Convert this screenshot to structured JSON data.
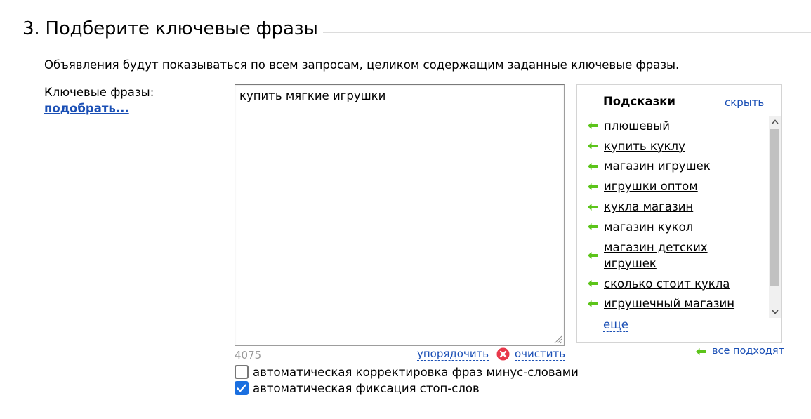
{
  "section": {
    "title": "3. Подберите ключевые фразы",
    "description": "Объявления будут показываться по всем запросам, целиком содержащим заданные ключевые фразы."
  },
  "keywords": {
    "label": "Ключевые фразы:",
    "pick_link": "подобрать...",
    "value": "купить мягкие игрушки",
    "char_count": "4075",
    "sort_label": "упорядочить",
    "clear_label": "очистить"
  },
  "options": [
    {
      "label": "автоматическая корректировка фраз минус-словами",
      "checked": false
    },
    {
      "label": "автоматическая фиксация стоп-слов",
      "checked": true
    }
  ],
  "hints": {
    "title": "Подсказки",
    "hide_label": "скрыть",
    "items": [
      "плюшевый",
      "купить куклу",
      "магазин игрушек",
      "игрушки оптом",
      "кукла магазин",
      "магазин кукол",
      "магазин детских игрушек",
      "сколько стоит кукла",
      "игрушечный магазин"
    ],
    "more_label": "еще",
    "all_fit_label": "все подходят"
  },
  "colors": {
    "link": "#1a4fb5",
    "arrow": "#5cc41a",
    "checkbox_checked": "#1a6fe0",
    "clear_icon": "#e8384a"
  },
  "icons": {
    "hint_arrow": "green-left-arrow-icon",
    "clear": "red-x-circle-icon",
    "checked": "checkmark-icon",
    "scroll_up": "chevron-up-icon",
    "scroll_down": "chevron-down-icon"
  }
}
